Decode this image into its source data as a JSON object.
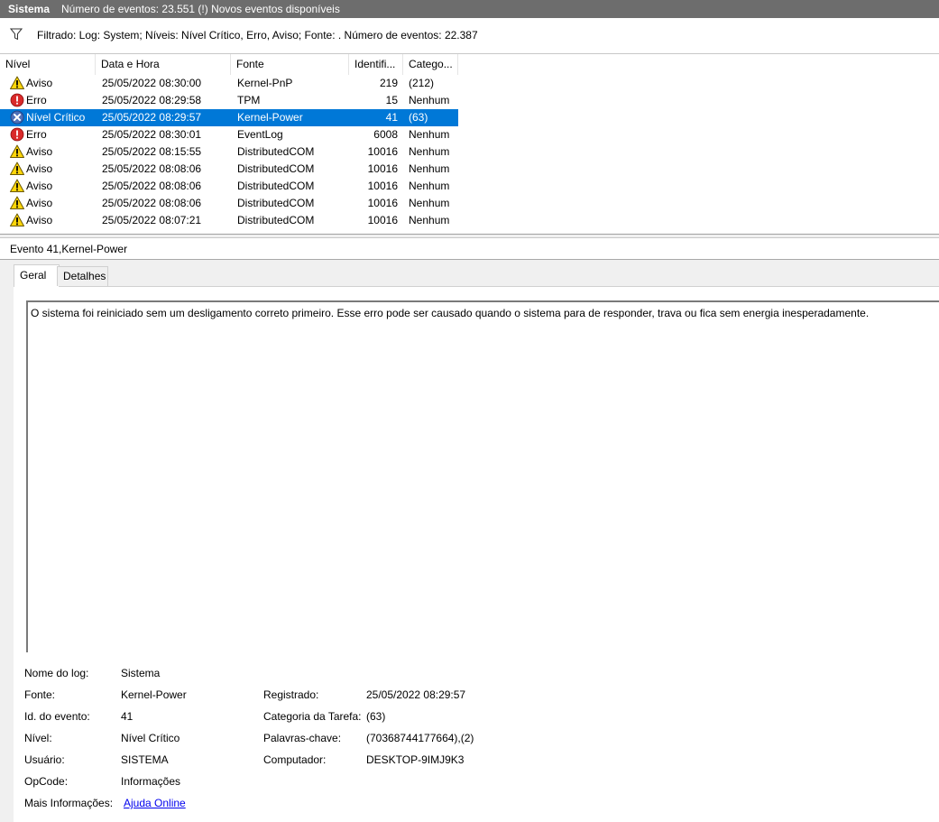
{
  "titlebar": {
    "name": "Sistema",
    "info": "Número de eventos: 23.551 (!) Novos eventos disponíveis"
  },
  "filter": {
    "text": "Filtrado: Log: System; Níveis: Nível Crítico, Erro, Aviso; Fonte: . Número de eventos: 22.387"
  },
  "columns": {
    "level": "Nível",
    "datetime": "Data e Hora",
    "source": "Fonte",
    "id": "Identifi...",
    "category": "Catego..."
  },
  "events": [
    {
      "icon": "warning",
      "level": "Aviso",
      "datetime": "25/05/2022 08:30:00",
      "source": "Kernel-PnP",
      "id": "219",
      "category": "(212)"
    },
    {
      "icon": "error",
      "level": "Erro",
      "datetime": "25/05/2022 08:29:58",
      "source": "TPM",
      "id": "15",
      "category": "Nenhum"
    },
    {
      "icon": "critical",
      "level": "Nível Crítico",
      "datetime": "25/05/2022 08:29:57",
      "source": "Kernel-Power",
      "id": "41",
      "category": "(63)"
    },
    {
      "icon": "error",
      "level": "Erro",
      "datetime": "25/05/2022 08:30:01",
      "source": "EventLog",
      "id": "6008",
      "category": "Nenhum"
    },
    {
      "icon": "warning",
      "level": "Aviso",
      "datetime": "25/05/2022 08:15:55",
      "source": "DistributedCOM",
      "id": "10016",
      "category": "Nenhum"
    },
    {
      "icon": "warning",
      "level": "Aviso",
      "datetime": "25/05/2022 08:08:06",
      "source": "DistributedCOM",
      "id": "10016",
      "category": "Nenhum"
    },
    {
      "icon": "warning",
      "level": "Aviso",
      "datetime": "25/05/2022 08:08:06",
      "source": "DistributedCOM",
      "id": "10016",
      "category": "Nenhum"
    },
    {
      "icon": "warning",
      "level": "Aviso",
      "datetime": "25/05/2022 08:08:06",
      "source": "DistributedCOM",
      "id": "10016",
      "category": "Nenhum"
    },
    {
      "icon": "warning",
      "level": "Aviso",
      "datetime": "25/05/2022 08:07:21",
      "source": "DistributedCOM",
      "id": "10016",
      "category": "Nenhum"
    }
  ],
  "event_title": "Evento 41,Kernel-Power",
  "tabs": {
    "general": "Geral",
    "details": "Detalhes"
  },
  "description": "O sistema foi reiniciado sem um desligamento correto primeiro. Esse erro pode ser causado quando o sistema para de responder, trava ou fica sem energia inesperadamente.",
  "props": {
    "log_name_label": "Nome do log:",
    "log_name": "Sistema",
    "source_label": "Fonte:",
    "source": "Kernel-Power",
    "logged_label": "Registrado:",
    "logged": "25/05/2022 08:29:57",
    "event_id_label": "Id. do evento:",
    "event_id": "41",
    "task_category_label": "Categoria da Tarefa:",
    "task_category": "(63)",
    "level_label": "Nível:",
    "level": "Nível Crítico",
    "keywords_label": "Palavras-chave:",
    "keywords": "(70368744177664),(2)",
    "user_label": "Usuário:",
    "user": "SISTEMA",
    "computer_label": "Computador:",
    "computer": "DESKTOP-9IMJ9K3",
    "opcode_label": "OpCode:",
    "opcode": "Informações",
    "more_info_label": "Mais Informações:",
    "more_info_link": "Ajuda Online"
  },
  "colors": {
    "selection": "#0078d7",
    "titlebar": "#6d6d6d",
    "link": "#0000ee"
  }
}
